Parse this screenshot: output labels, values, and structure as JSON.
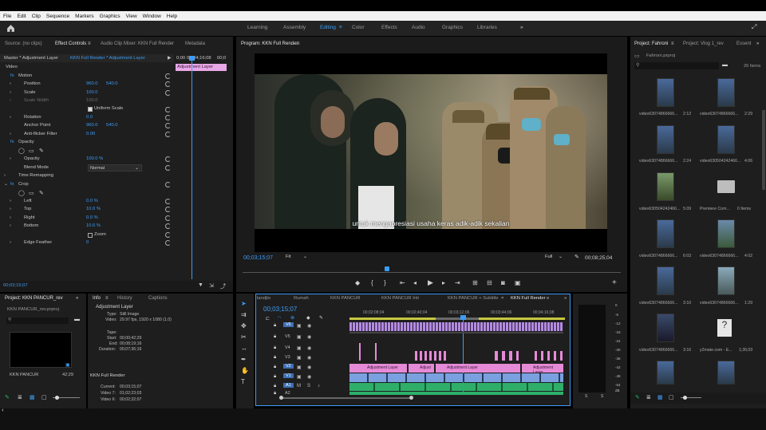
{
  "menu": [
    "File",
    "Edit",
    "Clip",
    "Sequence",
    "Markers",
    "Graphics",
    "View",
    "Window",
    "Help"
  ],
  "workspaces": [
    "Learning",
    "Assembly",
    "Editing",
    "Color",
    "Effects",
    "Audio",
    "Graphics",
    "Libraries"
  ],
  "workspace_active": "Editing",
  "left_top_tabs": [
    "Source: (no clips)",
    "Effect Controls",
    "Audio Clip Mixer: KKN Full Render",
    "Metadata"
  ],
  "effect_controls": {
    "master": "Master * Adjustment Layer",
    "sequence": "KKN Full Render * Adjustment Layer",
    "timecode_start": "0;00",
    "timecode_mid": "00;04;16;08",
    "timecode_end": "00;0",
    "clip_label": "Adjustment Layer",
    "section_video": "Video",
    "motion": "Motion",
    "position_label": "Position",
    "position_x": "960.0",
    "position_y": "540.0",
    "scale_label": "Scale",
    "scale_value": "100.0",
    "scale_width_label": "Scale Width",
    "scale_width_value": "100.0",
    "uniform_scale": "Uniform Scale",
    "rotation_label": "Rotation",
    "rotation_value": "0.0",
    "anchor_label": "Anchor Point",
    "anchor_x": "960.0",
    "anchor_y": "540.0",
    "antiflicker_label": "Anti-flicker Filter",
    "antiflicker_value": "0.00",
    "opacity": "Opacity",
    "opacity_label": "Opacity",
    "opacity_value": "100.0 %",
    "blend_label": "Blend Mode",
    "blend_value": "Normal",
    "time_remapping": "Time Remapping",
    "crop": "Crop",
    "left_label": "Left",
    "left_value": "0.0 %",
    "top_label": "Top",
    "top_value": "10.0 %",
    "right_label": "Right",
    "right_value": "0.0 %",
    "bottom_label": "Bottom",
    "bottom_value": "10.0 %",
    "zoom_label": "Zoom",
    "edge_label": "Edge Feather",
    "edge_value": "0",
    "current_time": "00;03;15;07"
  },
  "program": {
    "title": "Program: KKN Full Render",
    "timecode": "00;03;15;07",
    "fit": "Fit",
    "quality": "Full",
    "duration": "00;08;25;04",
    "subtitle": "untuk mengapresiasi usaha keras adik-adik sekalian"
  },
  "project_left": {
    "title": "Project: KKN PANCUR_rev",
    "file": "KKN PANCUR_rev.prproj",
    "item_name": "KKN PANCUR",
    "item_duration": "42;29"
  },
  "info": {
    "tabs": [
      "Info",
      "History",
      "Captions"
    ],
    "name": "Adjustment Layer",
    "type_label": "Type:",
    "type_value": "Still Image",
    "video_label": "Video:",
    "video_value": "29.97 fps, 1920 x 1080 (1.0)",
    "tape_label": "Tape:",
    "start_label": "Start:",
    "start_value": "00;00;42;29",
    "end_label": "End:",
    "end_value": "00;08;19;16",
    "dur_label": "Duration:",
    "dur_value": "00;07;36;16",
    "seq_name": "KKN Full Render",
    "current_label": "Current:",
    "current_value": "00;03;15;07",
    "v7_label": "Video 7:",
    "v7_value": "01;02;23;03",
    "v6_label": "Video 6:",
    "v6_value": "00;02;32;07"
  },
  "timeline": {
    "tabs": [
      "landjto",
      "Rumah",
      "KKN PANCUR",
      "KKN PANCUR Inti",
      "KKN PANCUR + Subtitle",
      "KKN Full Render"
    ],
    "timecode": "00;03;15;07",
    "ruler": [
      "00;02;08;04",
      "00;02;40;04",
      "00;03;12;06",
      "00;03;44;06",
      "00;04;16;08"
    ],
    "tracks": [
      "V6",
      "V5",
      "V4",
      "V3",
      "V2",
      "V1",
      "A1",
      "A2"
    ],
    "clip_adj": "Adjustment Layer",
    "clip_adj_short": "Adjust",
    "meter_ticks": [
      "0",
      "-6",
      "-12",
      "-18",
      "-24",
      "-30",
      "-36",
      "-42",
      "-48",
      "-54",
      "dB"
    ],
    "meter_s": [
      "S",
      "S"
    ]
  },
  "project_right": {
    "tabs": [
      "Project: Fahroni",
      "Project: Vlog 1_rev",
      "Essent"
    ],
    "file": "Fahroni.prproj",
    "count": "26 Items",
    "items": [
      {
        "name": "video63074866666...",
        "dur": "2:12"
      },
      {
        "name": "video63074866666...",
        "dur": "2:29"
      },
      {
        "name": "video63074866666...",
        "dur": "2:24"
      },
      {
        "name": "video630504242466...",
        "dur": "4:06"
      },
      {
        "name": "video630504242466...",
        "dur": "5:09"
      },
      {
        "name": "Premiere Com...",
        "dur": "0 Items"
      },
      {
        "name": "video63074866666...",
        "dur": "6:03"
      },
      {
        "name": "video63074866666...",
        "dur": "4:02"
      },
      {
        "name": "video63074866666...",
        "dur": "3:10"
      },
      {
        "name": "video63074866666...",
        "dur": "1:29"
      },
      {
        "name": "video63074866666...",
        "dur": "3:16"
      },
      {
        "name": "y2mate.com - E...",
        "dur": "1;36;03"
      }
    ]
  },
  "colors": {
    "accent": "#3d9cf5",
    "clip_pink": "#e58ad6",
    "clip_purple": "#b48be0",
    "audio_green": "#2fae6a",
    "panel": "#1e1e1e"
  }
}
